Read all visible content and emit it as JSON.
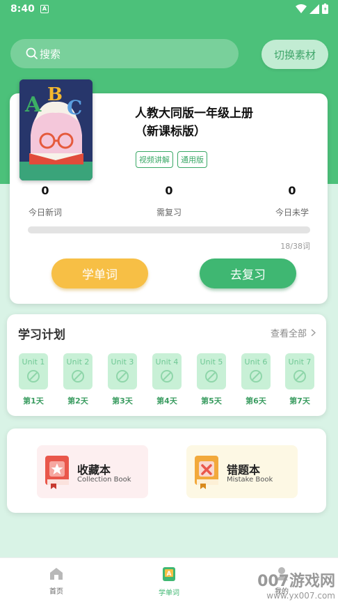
{
  "status_bar": {
    "time": "8:40",
    "notif_icon": "A"
  },
  "search": {
    "placeholder": "搜索",
    "switch_label": "切换素材"
  },
  "book": {
    "title_line1": "人教大同版一年级上册",
    "title_line2": "（新课标版）",
    "tags": [
      "视频讲解",
      "通用版"
    ],
    "stats": [
      {
        "value": "0",
        "label": "今日新词"
      },
      {
        "value": "0",
        "label": "需复习"
      },
      {
        "value": "0",
        "label": "今日未学"
      }
    ],
    "progress_fraction": 0.47,
    "progress_text": "18/38词",
    "learn_label": "学单词",
    "review_label": "去复习"
  },
  "plan": {
    "title": "学习计划",
    "view_all": "查看全部",
    "units": [
      {
        "name": "Unit 1",
        "day": "第1天"
      },
      {
        "name": "Unit 2",
        "day": "第2天"
      },
      {
        "name": "Unit 3",
        "day": "第3天"
      },
      {
        "name": "Unit 4",
        "day": "第4天"
      },
      {
        "name": "Unit 5",
        "day": "第5天"
      },
      {
        "name": "Unit 6",
        "day": "第6天"
      },
      {
        "name": "Unit 7",
        "day": "第7天"
      }
    ]
  },
  "books": {
    "collection": {
      "title": "收藏本",
      "subtitle": "Collection Book"
    },
    "mistake": {
      "title": "错题本",
      "subtitle": "Mistake Book"
    }
  },
  "nav": {
    "home": "首页",
    "words": "学单词",
    "mine": "我的"
  },
  "watermark": {
    "line1": "007游戏网",
    "line2": "www.yx007.com"
  },
  "colors": {
    "accent": "#4cc17a",
    "learn_button": "#f7bf45",
    "review_button": "#3fb772"
  }
}
